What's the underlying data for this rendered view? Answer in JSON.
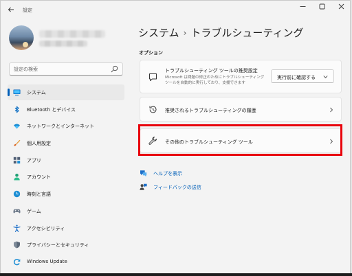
{
  "window": {
    "title": "設定"
  },
  "search": {
    "placeholder": "設定の検索"
  },
  "sidebar": {
    "items": [
      {
        "label": "システム",
        "icon": "system-icon",
        "active": true
      },
      {
        "label": "Bluetooth とデバイス",
        "icon": "bluetooth-icon"
      },
      {
        "label": "ネットワークとインターネット",
        "icon": "wifi-icon"
      },
      {
        "label": "個人用設定",
        "icon": "brush-icon"
      },
      {
        "label": "アプリ",
        "icon": "apps-icon"
      },
      {
        "label": "アカウント",
        "icon": "account-icon"
      },
      {
        "label": "時刻と言語",
        "icon": "time-language-icon"
      },
      {
        "label": "ゲーム",
        "icon": "game-icon"
      },
      {
        "label": "アクセシビリティ",
        "icon": "accessibility-icon"
      },
      {
        "label": "プライバシーとセキュリティ",
        "icon": "shield-icon"
      },
      {
        "label": "Windows Update",
        "icon": "windows-update-icon"
      }
    ]
  },
  "breadcrumb": {
    "parent": "システム",
    "current": "トラブルシューティング"
  },
  "options": {
    "section_title": "オプション",
    "recommended": {
      "title": "トラブルシューティング ツールの推奨設定",
      "description": "Microsoft は問題の修正のためにトラブルシューティング ツールを自動的に実行しており、支援できます",
      "dropdown_value": "実行前に確認する"
    },
    "history": {
      "title": "推奨されるトラブルシューティングの履歴"
    },
    "other": {
      "title": "その他のトラブルシューティング ツール"
    }
  },
  "links": {
    "help": "ヘルプを表示",
    "feedback": "フィードバックの送信"
  },
  "colors": {
    "accent": "#005fb8",
    "highlight": "#e8000b",
    "background": "#f3f3f3"
  }
}
